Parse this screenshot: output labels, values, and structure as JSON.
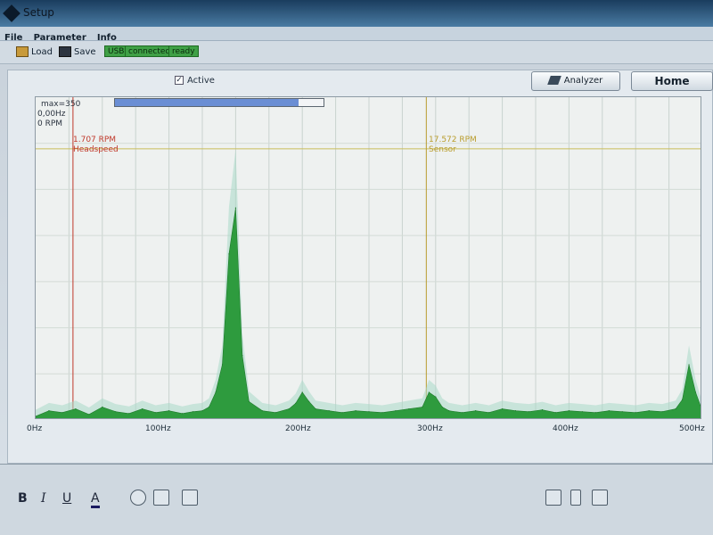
{
  "window": {
    "title": "Setup"
  },
  "menu": {
    "items": [
      "File",
      "Parameter",
      "Info"
    ]
  },
  "toolbar": {
    "load_label": "Load",
    "save_label": "Save",
    "status": [
      "USB",
      "connected",
      "ready"
    ]
  },
  "controls": {
    "active_label": "Active",
    "active_checked": "✓",
    "analyzer_label": "Analyzer",
    "home_label": "Home"
  },
  "spectrum": {
    "max_label": "max=350",
    "freq_readout": "0,00Hz",
    "rpm_readout": "0 RPM",
    "progress_fraction": 0.88,
    "markers": [
      {
        "value": "1.707 RPM",
        "name": "Headspeed",
        "color": "#c0392b",
        "freq_hz": 28
      },
      {
        "value": "17.572 RPM",
        "name": "Sensor",
        "color": "#b89c2c",
        "freq_hz": 293
      }
    ],
    "threshold_fraction": 0.84,
    "x_ticks": [
      "0Hz",
      "100Hz",
      "200Hz",
      "300Hz",
      "400Hz",
      "500Hz"
    ]
  },
  "chart_data": {
    "type": "area",
    "xlabel": "",
    "ylabel": "",
    "xlim": [
      0,
      500
    ],
    "ylim": [
      0,
      350
    ],
    "grid": true,
    "x": [
      0,
      10,
      20,
      30,
      40,
      50,
      60,
      70,
      80,
      90,
      100,
      110,
      118,
      125,
      130,
      135,
      140,
      145,
      150,
      155,
      160,
      170,
      180,
      190,
      195,
      200,
      205,
      210,
      220,
      230,
      240,
      250,
      260,
      270,
      280,
      290,
      295,
      300,
      305,
      310,
      320,
      330,
      340,
      350,
      360,
      370,
      380,
      390,
      400,
      410,
      420,
      430,
      440,
      450,
      460,
      470,
      480,
      485,
      490,
      495,
      500
    ],
    "series": [
      {
        "values": [
          4,
          10,
          8,
          12,
          6,
          14,
          9,
          7,
          12,
          8,
          10,
          7,
          9,
          10,
          14,
          30,
          60,
          180,
          230,
          70,
          20,
          10,
          8,
          12,
          18,
          30,
          20,
          12,
          10,
          8,
          10,
          9,
          8,
          10,
          12,
          14,
          30,
          25,
          14,
          10,
          8,
          10,
          8,
          12,
          10,
          9,
          11,
          8,
          10,
          9,
          8,
          10,
          9,
          8,
          10,
          9,
          12,
          22,
          60,
          30,
          10
        ]
      }
    ]
  }
}
